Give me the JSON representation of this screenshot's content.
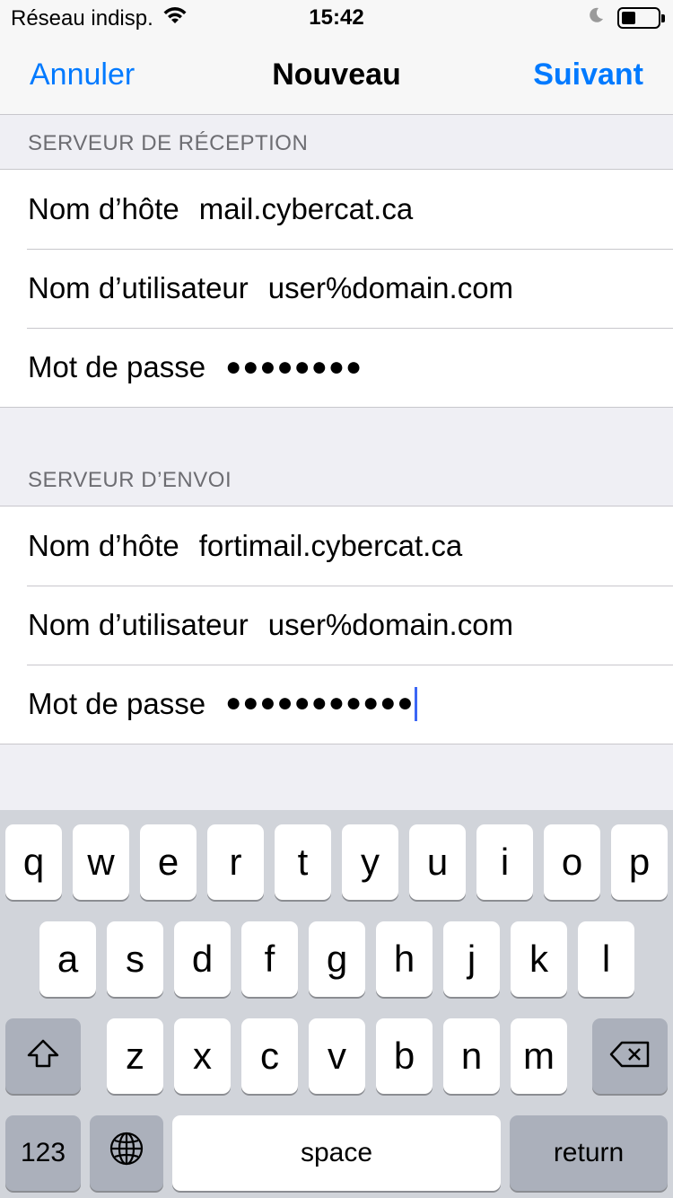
{
  "status_bar": {
    "carrier": "Réseau indisp.",
    "time": "15:42",
    "wifi_icon": "wifi-icon",
    "moon_icon": "do-not-disturb-icon",
    "battery_level": 0.4
  },
  "nav": {
    "cancel_label": "Annuler",
    "title": "Nouveau",
    "next_label": "Suivant",
    "accent_color": "#007aff"
  },
  "incoming": {
    "header": "SERVEUR DE RÉCEPTION",
    "host_label": "Nom d’hôte",
    "host_value": "mail.cybercat.ca",
    "user_label": "Nom d’utilisateur",
    "user_value": "user%domain.com",
    "password_label": "Mot de passe",
    "password_value": "●●●●●●●●"
  },
  "outgoing": {
    "header": "SERVEUR D’ENVOI",
    "host_label": "Nom d’hôte",
    "host_value": "fortimail.cybercat.ca",
    "user_label": "Nom d’utilisateur",
    "user_value": "user%domain.com",
    "password_label": "Mot de passe",
    "password_value": "●●●●●●●●●●●"
  },
  "keyboard": {
    "row1": [
      "q",
      "w",
      "e",
      "r",
      "t",
      "y",
      "u",
      "i",
      "o",
      "p"
    ],
    "row2": [
      "a",
      "s",
      "d",
      "f",
      "g",
      "h",
      "j",
      "k",
      "l"
    ],
    "row3": [
      "z",
      "x",
      "c",
      "v",
      "b",
      "n",
      "m"
    ],
    "shift_icon": "shift-icon",
    "delete_icon": "delete-icon",
    "globe_icon": "globe-icon",
    "numbers_label": "123",
    "space_label": "space",
    "return_label": "return"
  }
}
